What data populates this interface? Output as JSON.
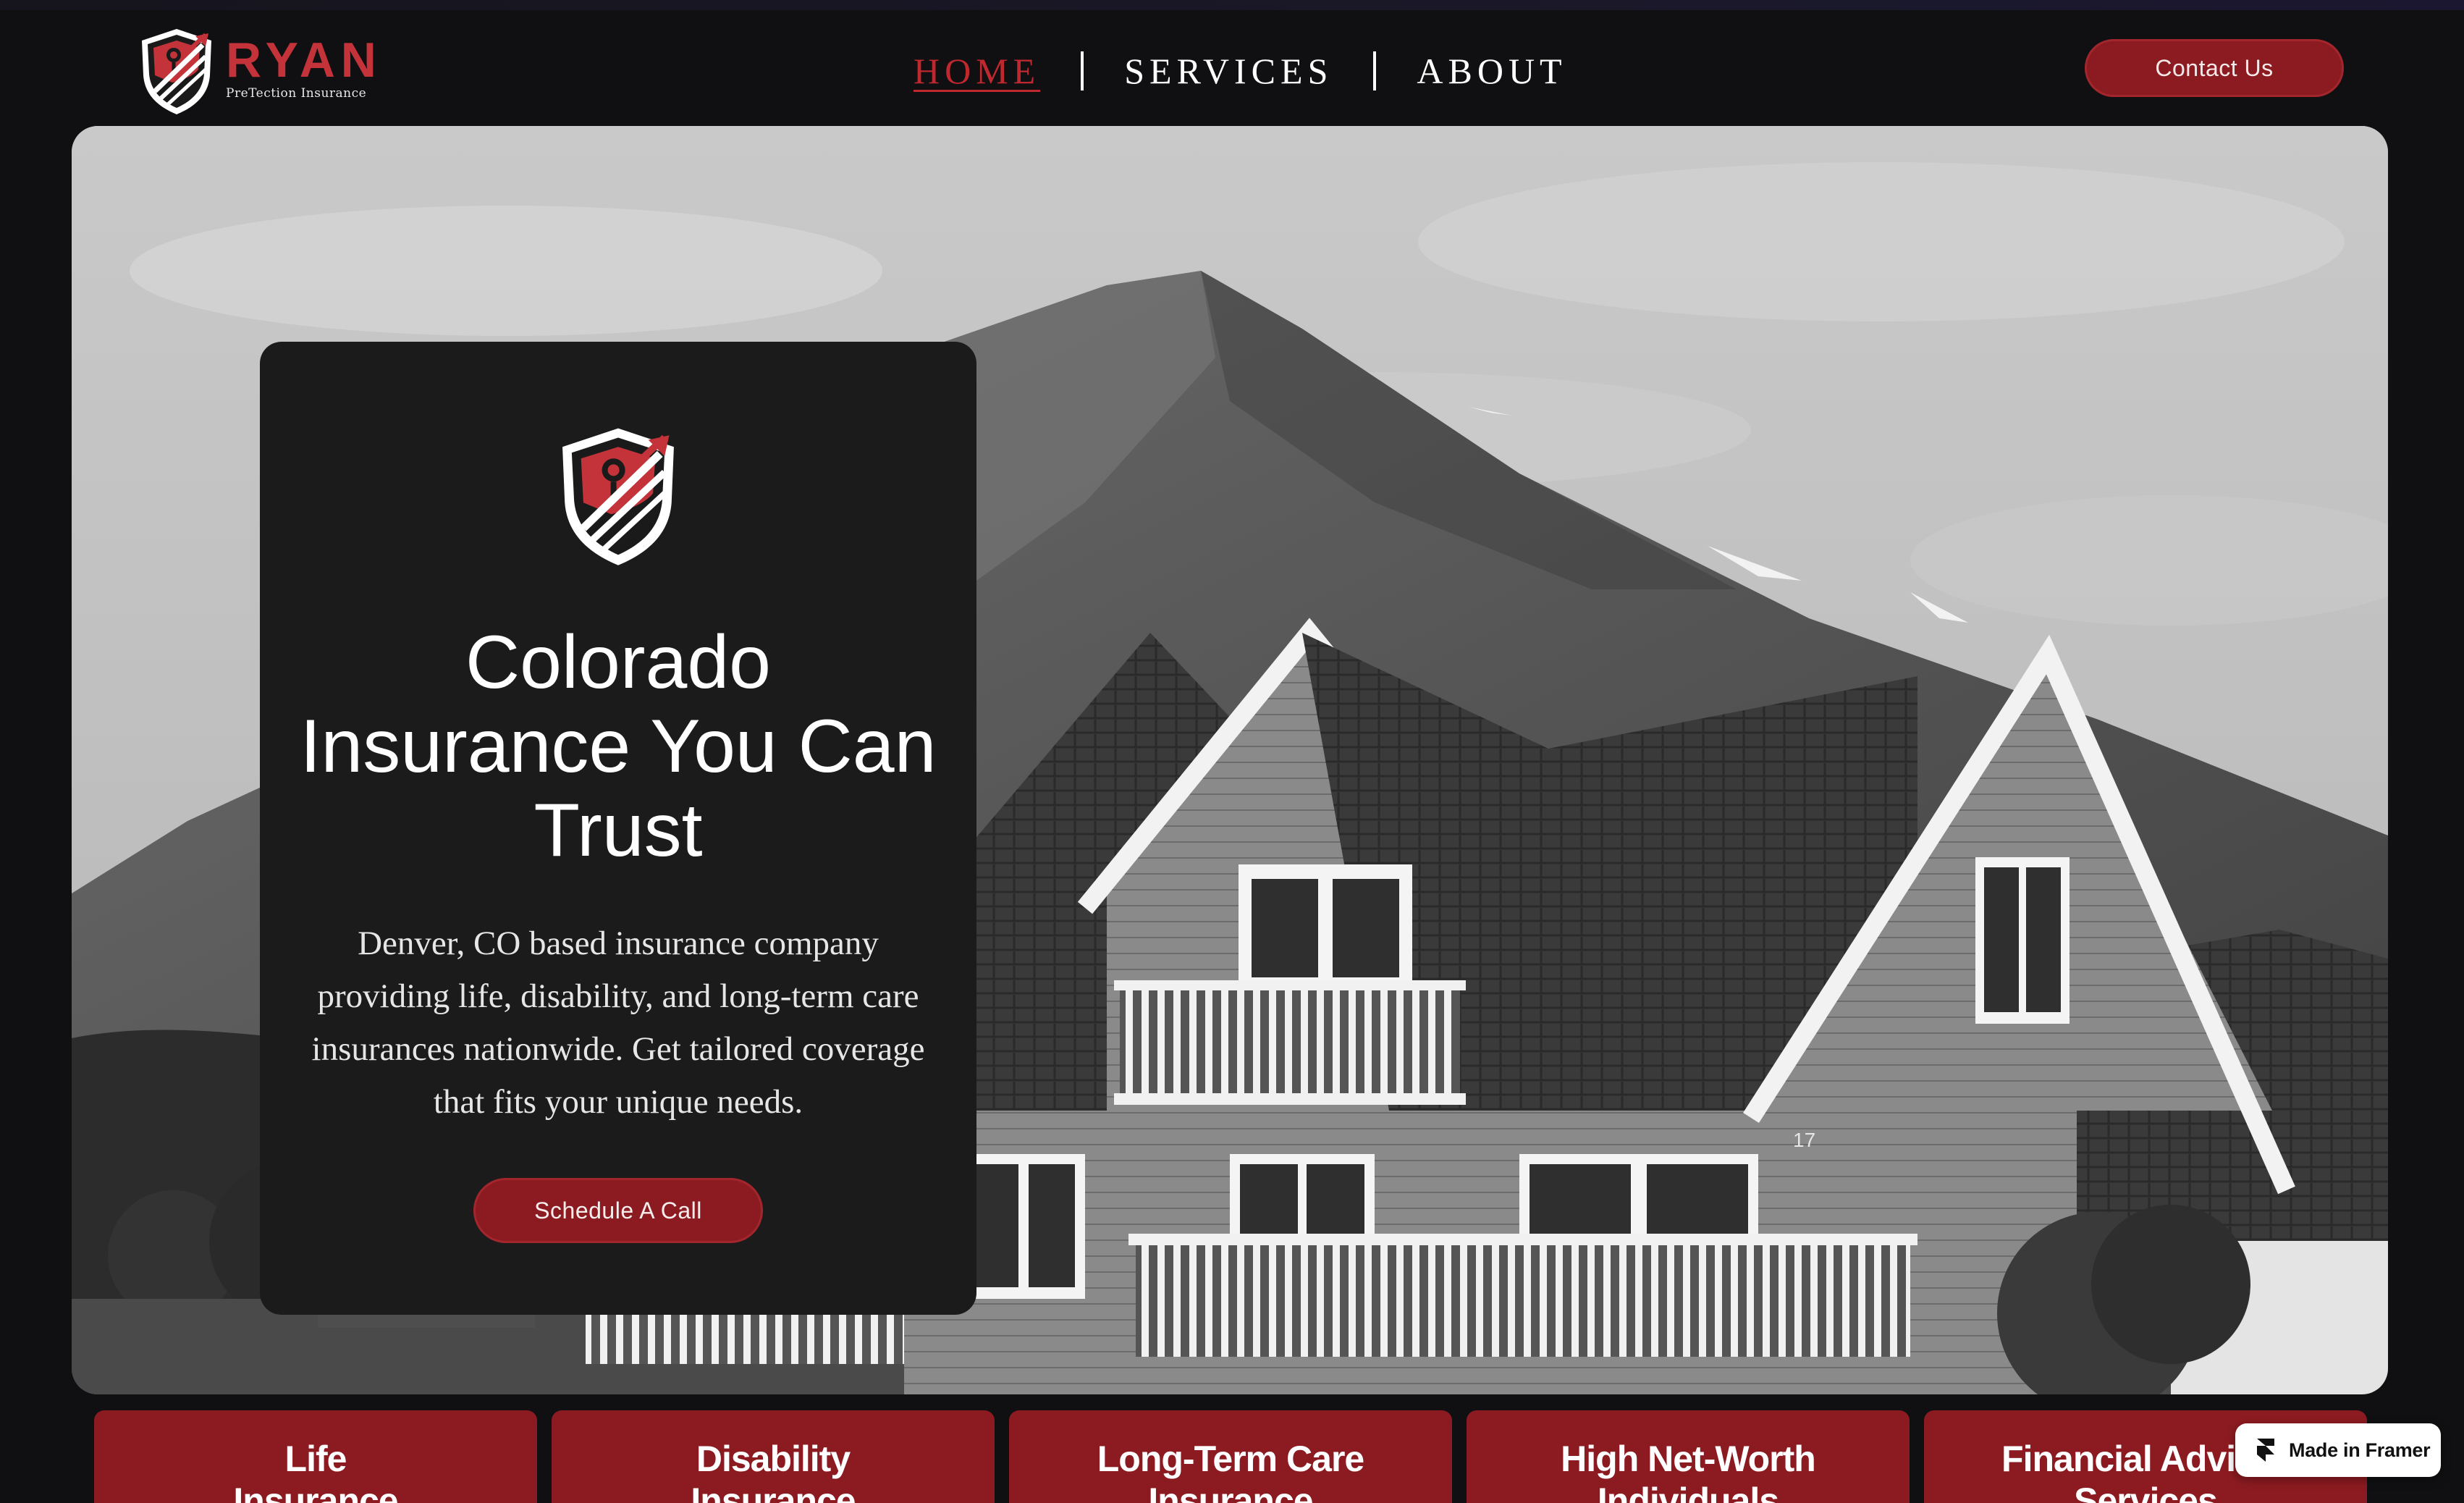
{
  "brand": {
    "name": "RYAN",
    "tagline": "PreTection Insurance",
    "colors": {
      "accent": "#8c1b21",
      "accent_bright": "#c4333a",
      "background": "#101012",
      "card": "#1b1b1c"
    }
  },
  "nav": {
    "items": [
      {
        "label": "HOME",
        "active": true
      },
      {
        "label": "SERVICES",
        "active": false
      },
      {
        "label": "ABOUT",
        "active": false
      }
    ],
    "contact_label": "Contact Us"
  },
  "hero": {
    "title": "Colorado Insurance You Can Trust",
    "description": "Denver, CO based insurance company providing life, disability, and long-term care insurances nationwide. Get tailored coverage that fits your unique needs.",
    "cta_label": "Schedule A Call",
    "house_number": "17"
  },
  "services": [
    {
      "label": "Life",
      "second_line": "Insurance"
    },
    {
      "label": "Disability",
      "second_line": "Insurance"
    },
    {
      "label": "Long-Term Care",
      "second_line": "Insurance"
    },
    {
      "label": "High Net-Worth",
      "second_line": "Individuals"
    },
    {
      "label": "Financial Advisor",
      "second_line": "Services"
    }
  ],
  "badge": {
    "label": "Made in Framer",
    "icon": "framer-icon"
  }
}
